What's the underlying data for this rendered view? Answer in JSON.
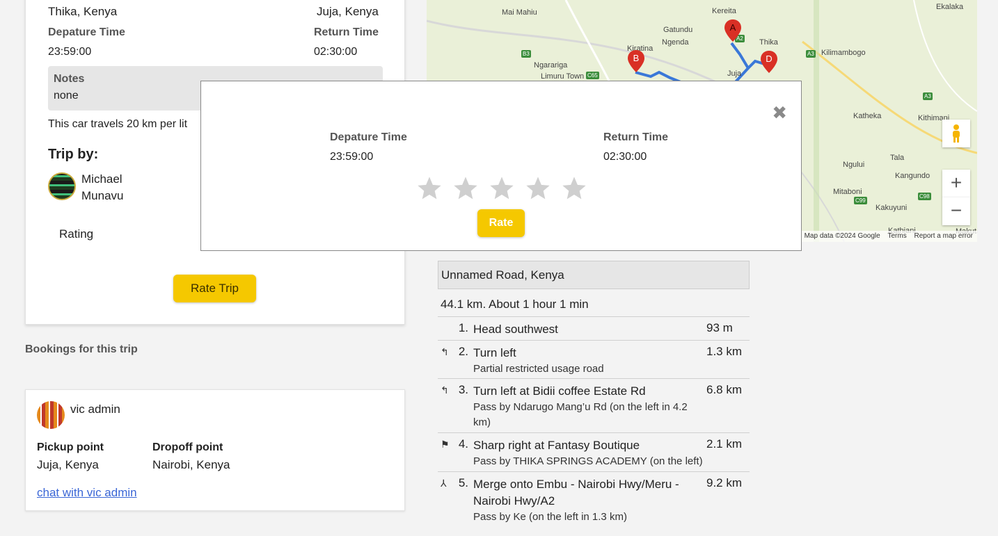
{
  "trip": {
    "from": "Thika, Kenya",
    "to": "Juja, Kenya",
    "departure_label": "Depature Time",
    "departure_value": "23:59:00",
    "return_label": "Return Time",
    "return_value": "02:30:00",
    "notes_label": "Notes",
    "notes_value": "none",
    "travel_note": "This car travels 20 km per lit",
    "tripby_label": "Trip by:",
    "driver_first": "Michael",
    "driver_last": "Munavu",
    "rating_label": "Rating",
    "rate_trip_button": "Rate Trip"
  },
  "bookings": {
    "title": "Bookings for this trip",
    "items": [
      {
        "name": "vic admin",
        "pickup_label": "Pickup point",
        "pickup_value": "Juja, Kenya",
        "dropoff_label": "Dropoff point",
        "dropoff_value": "Nairobi, Kenya",
        "chat_link": "chat with vic admin"
      }
    ]
  },
  "map": {
    "labels": [
      "Mai Mahiu",
      "Gatundu",
      "Kereita",
      "Ngenda",
      "Kiratina",
      "Ngarariga",
      "Limuru Town",
      "Thika",
      "Juja",
      "Kilimambogo",
      "Ekalaka",
      "Katheka",
      "Kithimani",
      "Ngului",
      "Tala",
      "Kangundo",
      "Mitaboni",
      "Kakuyuni",
      "Kathiani",
      "Makutan"
    ],
    "shields": [
      "B3",
      "C65",
      "A3",
      "A3",
      "C99",
      "C98",
      "A2"
    ],
    "markers": [
      "A",
      "B",
      "D"
    ],
    "footer": {
      "map_data": "Map data ©2024 Google",
      "terms": "Terms",
      "report": "Report a map error"
    },
    "zoom_in": "+",
    "zoom_out": "−",
    "route_color": "#3a78d8",
    "marker_color": "#d93025"
  },
  "directions": {
    "address": "Unnamed Road, Kenya",
    "summary": "44.1 km. About 1 hour 1 min",
    "steps": [
      {
        "num": "1.",
        "icon": "",
        "main": "Head southwest",
        "sub": "",
        "dist": "93 m"
      },
      {
        "num": "2.",
        "icon": "turn-left-icon",
        "main": "Turn left",
        "sub": "Partial restricted usage road",
        "dist": "1.3 km"
      },
      {
        "num": "3.",
        "icon": "turn-left-icon",
        "main": "Turn left at Bidii coffee Estate Rd",
        "sub": "Pass by Ndarugo Mang’u Rd (on the left in 4.2 km)",
        "dist": "6.8 km"
      },
      {
        "num": "4.",
        "icon": "sharp-right-icon",
        "main": "Sharp right at Fantasy Boutique",
        "sub": "Pass by THIKA SPRINGS ACADEMY (on the left)",
        "dist": "2.1 km"
      },
      {
        "num": "5.",
        "icon": "merge-icon",
        "main": "Merge onto Embu - Nairobi Hwy/Meru - Nairobi Hwy/A2",
        "sub": "Pass by Ke (on the left in 1.3 km)",
        "dist": "9.2 km"
      }
    ]
  },
  "modal": {
    "departure_label": "Depature Time",
    "departure_value": "23:59:00",
    "return_label": "Return Time",
    "return_value": "02:30:00",
    "stars_total": 5,
    "stars_selected": 0,
    "rate_button": "Rate",
    "star_color": "#cfcfcf",
    "button_color": "#f5c800"
  }
}
